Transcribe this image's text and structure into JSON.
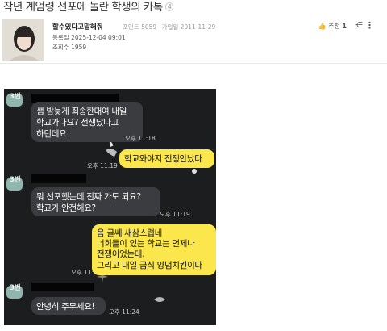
{
  "post": {
    "title": "작년 계엄령 선포에 놀란 학생의 카톡",
    "comment_count": "4",
    "author": "할수있다고말해줘",
    "points": "포인트 5059",
    "joined": "가입일 2011-11-29",
    "registered": "등록일 2025-12-04 09:01",
    "views": "조회수 1959",
    "recommend_label": "추천",
    "recommend_count": "1",
    "share_icon": "share-icon",
    "more_icon": "more-vertical-icon"
  },
  "chat": {
    "speaker_label": "3번",
    "messages": [
      {
        "side": "in",
        "text_lines": [
          "샘 밤늦게 죄송한대여 내일",
          "학교가나요? 전쟁났다고",
          "하던데요"
        ],
        "time": "오후 11:18"
      },
      {
        "side": "out",
        "text_lines": [
          "학교와야지 전쟁안났다"
        ],
        "time": "오후 11:19"
      },
      {
        "side": "in",
        "text_lines": [
          "뭐 선포했는데 진짜 가도 되요?",
          "학교가 안전해요?"
        ],
        "time": "오후 11:19"
      },
      {
        "side": "out",
        "text_lines": [
          "음 글쎄 새삼스럽네",
          "너희들이 있는 학교는 언제나",
          "전쟁이었는데.",
          "그리고 내일 급식 양념치킨이다"
        ],
        "time": "오후 11:23"
      },
      {
        "side": "in",
        "text_lines": [
          "안녕히 주무세요!"
        ],
        "time": "오후 11:24"
      }
    ]
  },
  "colors": {
    "chat_bg": "#1b1d1f",
    "bubble_in": "#3a3c3f",
    "bubble_out": "#fbe74b",
    "avatar_badge": "#8fb7ad"
  }
}
